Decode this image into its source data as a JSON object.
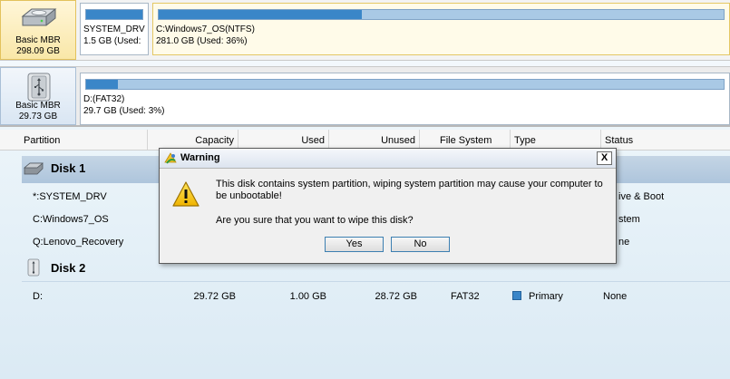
{
  "disks": [
    {
      "label": "Basic MBR",
      "size": "298.09 GB",
      "icon": "hard-drive-icon",
      "partitions": [
        {
          "name_line": "SYSTEM_DRV(I",
          "size_line": "1.5 GB (Used:",
          "used_fraction": 1.0
        },
        {
          "name_line": "C:Windows7_OS(NTFS)",
          "size_line": "281.0 GB (Used: 36%)",
          "used_fraction": 0.36
        }
      ]
    },
    {
      "label": "Basic MBR",
      "size": "29.73 GB",
      "icon": "usb-drive-icon",
      "partitions": [
        {
          "name_line": "D:(FAT32)",
          "size_line": "29.7 GB (Used: 3%)",
          "used_fraction": 0.03
        }
      ]
    }
  ],
  "table": {
    "columns": [
      "Partition",
      "Capacity",
      "Used",
      "Unused",
      "File System",
      "Type",
      "Status"
    ],
    "groups": [
      {
        "title": "Disk 1",
        "rows": [
          {
            "partition": "*:SYSTEM_DRV",
            "status_visible": "ive & Boot"
          },
          {
            "partition": "C:Windows7_OS",
            "status_visible": "stem"
          },
          {
            "partition": "Q:Lenovo_Recovery",
            "status_visible": "ne"
          }
        ]
      },
      {
        "title": "Disk 2",
        "rows": [
          {
            "partition": "D:",
            "capacity": "29.72 GB",
            "used": "1.00 GB",
            "unused": "28.72 GB",
            "file_system": "FAT32",
            "type": "Primary",
            "status": "None"
          }
        ]
      }
    ]
  },
  "dialog": {
    "title": "Warning",
    "close_label": "X",
    "message": "This disk contains system partition, wiping system partition may cause your computer to be unbootable!",
    "question": "Are you sure that you want to wipe this disk?",
    "yes_label": "Yes",
    "no_label": "No"
  },
  "colors": {
    "usage_fill": "#3a86c8",
    "usage_bg": "#a9c9e5",
    "disk_group_bg": "#b7cde2",
    "selected_disk_bg": "#f9e7a8"
  }
}
